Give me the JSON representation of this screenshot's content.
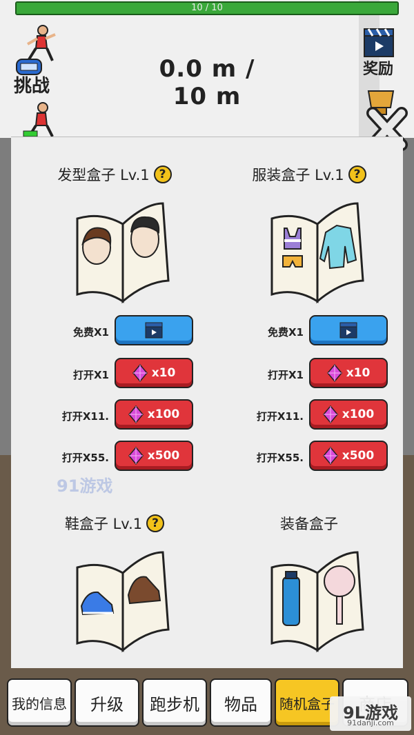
{
  "hud": {
    "progress_text": "10 / 10",
    "progress_fraction": 1.0,
    "distance": "0.0 m / 10 m",
    "challenge_label": "挑战",
    "reward_label": "奖励"
  },
  "boxes": [
    {
      "title": "发型盒子 Lv.1",
      "rows": [
        {
          "label": "免费X1",
          "type": "video"
        },
        {
          "label": "打开X1",
          "type": "gem",
          "cost": "x10"
        },
        {
          "label": "打开X11.",
          "type": "gem",
          "cost": "x100"
        },
        {
          "label": "打开X55.",
          "type": "gem",
          "cost": "x500"
        }
      ]
    },
    {
      "title": "服装盒子 Lv.1",
      "rows": [
        {
          "label": "免费X1",
          "type": "video"
        },
        {
          "label": "打开X1",
          "type": "gem",
          "cost": "x10"
        },
        {
          "label": "打开X11.",
          "type": "gem",
          "cost": "x100"
        },
        {
          "label": "打开X55.",
          "type": "gem",
          "cost": "x500"
        }
      ]
    },
    {
      "title": "鞋盒子 Lv.1"
    },
    {
      "title": "装备盒子"
    }
  ],
  "help_symbol": "?",
  "tabs": [
    "我的信息",
    "升级",
    "跑步机",
    "物品",
    "随机盒子",
    "商店"
  ],
  "active_tab_index": 4,
  "watermark": {
    "text": "9L游戏",
    "sub": "91danji.com",
    "center": "91游戏"
  },
  "colors": {
    "blue_button": "#3aa2ee",
    "red_button": "#e0353b",
    "active_tab": "#f6c623",
    "help_badge": "#f2c21a"
  }
}
